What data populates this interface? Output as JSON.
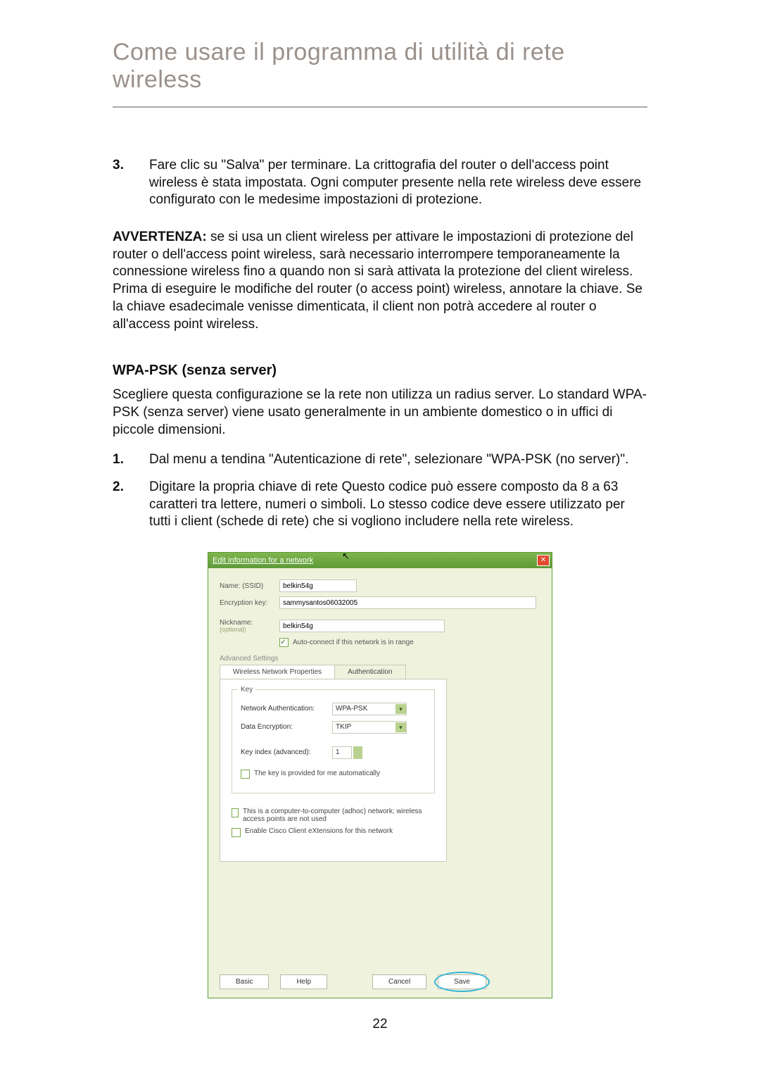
{
  "title": "Come usare il programma di utilità di rete wireless",
  "step3": {
    "num": "3.",
    "text": "Fare clic su \"Salva\" per terminare. La crittografia del router o dell'access point wireless è stata impostata. Ogni computer presente nella rete wireless deve essere configurato con le medesime impostazioni di protezione."
  },
  "warning": {
    "label": "AVVERTENZA:",
    "text": " se si usa un client wireless per attivare le impostazioni di protezione del router o dell'access point wireless, sarà necessario interrompere temporaneamente la connessione wireless fino a quando non si sarà attivata la protezione del client wireless. Prima di eseguire le modifiche del router (o access point) wireless, annotare la chiave. Se la chiave esadecimale venisse dimenticata, il client non potrà accedere al router o all'access point wireless."
  },
  "wpa": {
    "heading": "WPA-PSK (senza server)",
    "intro": "Scegliere questa configurazione se la rete non utilizza un radius server. Lo standard WPA-PSK (senza server) viene usato generalmente in un ambiente domestico o in uffici di piccole dimensioni.",
    "steps": [
      {
        "num": "1.",
        "text": "Dal menu a tendina \"Autenticazione di rete\", selezionare \"WPA-PSK (no server)\"."
      },
      {
        "num": "2.",
        "text": "Digitare la propria chiave di rete Questo codice può essere composto da 8 a 63 caratteri tra lettere, numeri o simboli. Lo stesso codice deve essere utilizzato per tutti i client (schede di rete) che si vogliono includere nella rete wireless."
      }
    ]
  },
  "dialog": {
    "titlebar": "Edit information for a network",
    "close": "✕",
    "name_label": "Name: (SSID)",
    "name_value": "belkin54g",
    "enc_label": "Encryption key:",
    "enc_value": "sammysantos06032005",
    "nick_label": "Nickname:",
    "nick_opt": "(optional)",
    "nick_value": "belkin54g",
    "auto_connect": "Auto-connect if this network is in range",
    "adv_settings": "Advanced Settings",
    "tab_props": "Wireless Network Properties",
    "tab_auth": "Authentication",
    "group_key": "Key",
    "net_auth_label": "Network Authentication:",
    "net_auth_value": "WPA-PSK",
    "enc_type_label": "Data Encryption:",
    "enc_type_value": "TKIP",
    "key_index_label": "Key index (advanced):",
    "key_index_value": "1",
    "key_auto": "The key is provided for me automatically",
    "adhoc": "This is a computer-to-computer (adhoc) network; wireless access points are not used",
    "cisco": "Enable Cisco Client eXtensions for this network",
    "btn_basic": "Basic",
    "btn_help": "Help",
    "btn_cancel": "Cancel",
    "btn_save": "Save"
  },
  "page_number": "22"
}
